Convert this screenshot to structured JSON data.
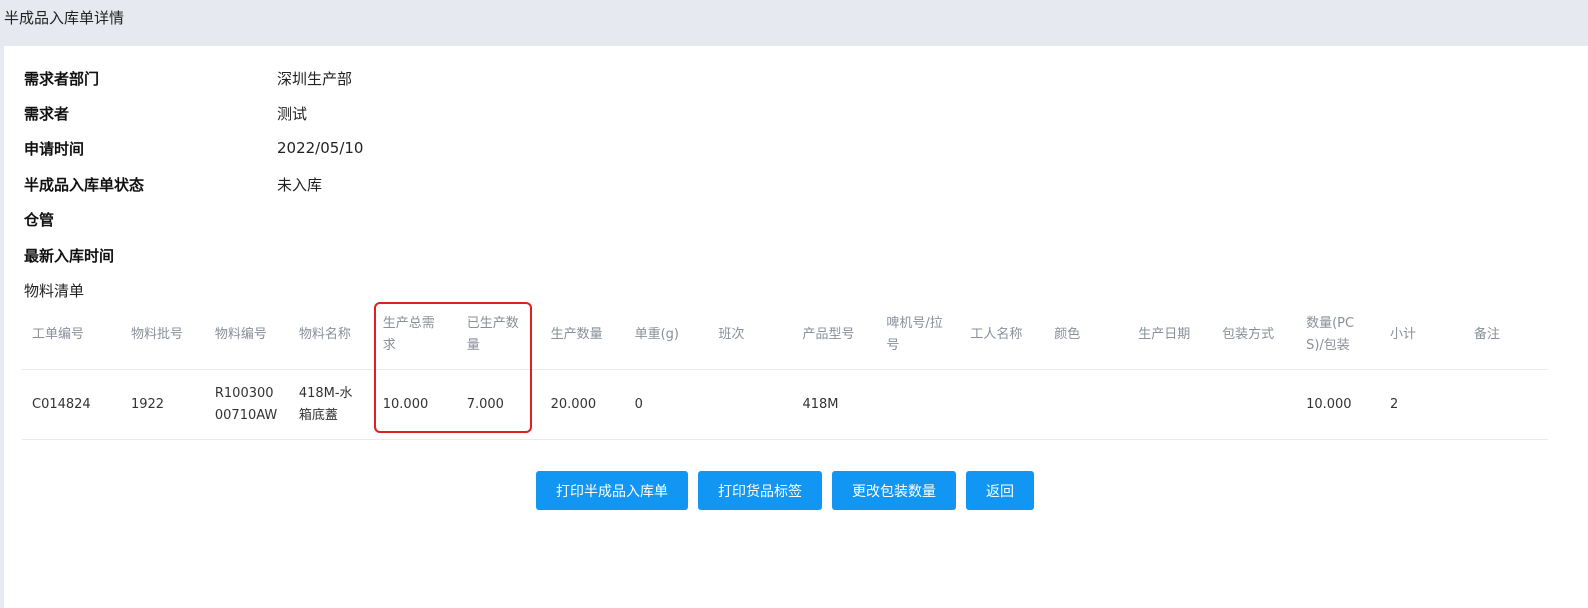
{
  "page": {
    "title": "半成品入库单详情"
  },
  "info": [
    {
      "label": "需求者部门",
      "value": "深圳生产部"
    },
    {
      "label": "需求者",
      "value": "测试"
    },
    {
      "label": "申请时间",
      "value": "2022/05/10"
    },
    {
      "label": "半成品入库单状态",
      "value": "未入库"
    },
    {
      "label": "仓管",
      "value": ""
    },
    {
      "label": "最新入库时间",
      "value": ""
    }
  ],
  "materials": {
    "title": "物料清单",
    "columns": [
      "工单编号",
      "物料批号",
      "物料编号",
      "物料名称",
      "生产总需求",
      "已生产数量",
      "生产数量",
      "单重(g)",
      "班次",
      "产品型号",
      "啤机号/拉号",
      "工人名称",
      "颜色",
      "生产日期",
      "包装方式",
      "数量(PCS)/包装",
      "小计",
      "备注"
    ],
    "rows": [
      [
        "C014824",
        "1922",
        "R10030000710AW",
        "418M-水箱底蓋",
        "10.000",
        "7.000",
        "20.000",
        "0",
        "",
        "418M",
        "",
        "",
        "",
        "",
        "",
        "10.000",
        "2",
        ""
      ]
    ]
  },
  "actions": {
    "print_receipt": "打印半成品入库单",
    "print_label": "打印货品标签",
    "change_pack_qty": "更改包装数量",
    "back": "返回"
  },
  "colors": {
    "primary": "#1296f3",
    "highlight": "#e02020"
  }
}
